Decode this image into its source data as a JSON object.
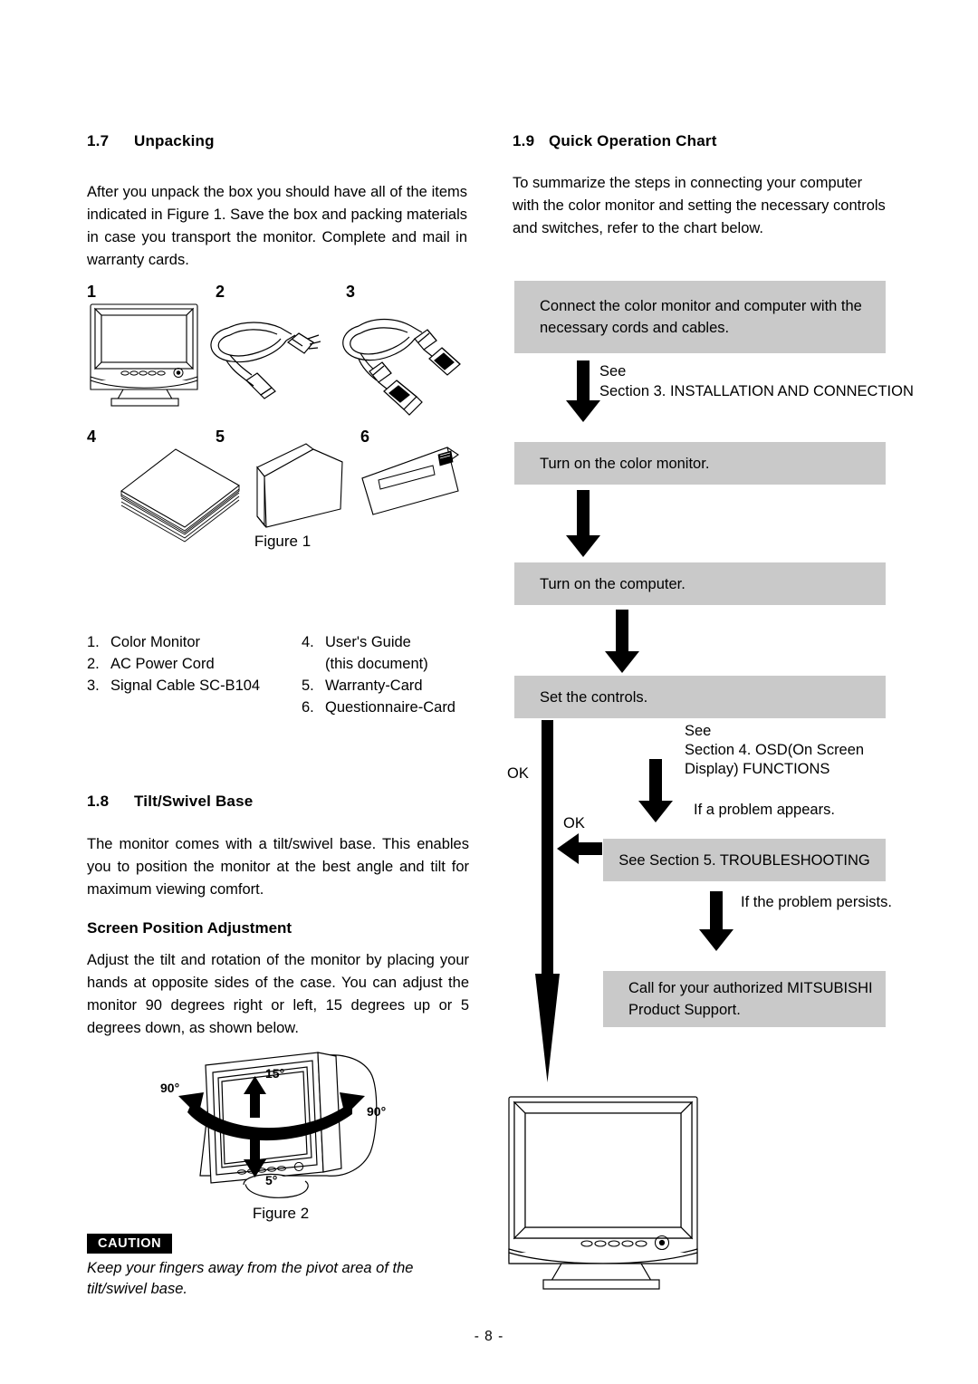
{
  "left_column": {
    "unpacking": {
      "number": "1.7",
      "title": "Unpacking",
      "paragraph": "After you unpack the box you should have all of the items indicated in Figure 1.  Save the box and packing materials in case you  transport the monitor.  Complete and mail in warranty cards."
    },
    "figure1": {
      "caption": "Figure  1",
      "callouts": [
        "1",
        "2",
        "3",
        "4",
        "5",
        "6"
      ],
      "items_left": [
        {
          "index": "1.",
          "label": "Color Monitor"
        },
        {
          "index": "2.",
          "label": "AC Power Cord"
        },
        {
          "index": "3.",
          "label": "Signal Cable SC-B104"
        }
      ],
      "items_right": [
        {
          "index": "4.",
          "label": "User's Guide",
          "continuation": "(this document)"
        },
        {
          "index": "5.",
          "label": "Warranty-Card"
        },
        {
          "index": "6.",
          "label": "Questionnaire-Card"
        }
      ]
    },
    "tilt_swivel": {
      "number": "1.8",
      "title": "Tilt/Swivel Base",
      "paragraph": "The monitor comes with a tilt/swivel base.  This enables you to position the monitor at  the best angle and tilt for maximum viewing comfort.",
      "subheading": "Screen Position Adjustment",
      "sub_paragraph": "Adjust the tilt and rotation of the monitor by placing your hands at opposite sides of the case.  You can adjust the monitor 90 degrees right or left, 15 degrees up or 5 degrees down, as shown below."
    },
    "figure2": {
      "caption": "Figure  2",
      "angle_left": "90°",
      "angle_right": "90°",
      "angle_up": "15°",
      "angle_down": "5°"
    },
    "caution": {
      "tag": "CAUTION",
      "text": "Keep your fingers away from the pivot area of the tilt/swivel base."
    }
  },
  "right_column": {
    "heading": {
      "number": "1.9",
      "title": "Quick Operation Chart"
    },
    "intro": "To summarize the steps in connecting your computer with the color monitor and setting the necessary controls and switches, refer to the chart below.",
    "flow": {
      "box_connect": "Connect the color monitor and computer with the necessary cords and cables.",
      "note_see_1": "See",
      "note_section_3": "Section 3. INSTALLATION AND CONNECTION",
      "box_turn_on_monitor": "Turn on the color monitor.",
      "box_turn_on_computer": "Turn on the computer.",
      "box_set_controls": "Set the controls.",
      "note_see_2": "See",
      "note_section_4_line1": "Section 4. OSD(On Screen",
      "note_section_4_line2": "Display) FUNCTIONS",
      "note_problem_appears": "If a problem appears.",
      "box_troubleshooting": "See Section 5. TROUBLESHOOTING",
      "note_problem_persists": "If the problem persists.",
      "box_call_support": "Call for your authorized MITSUBISHI Product Support.",
      "ok_label_top": "OK",
      "ok_label_mid": "OK"
    }
  },
  "footer": {
    "page_number": "- 8 -"
  },
  "colors": {
    "flow_box_fill": "#c9c9c9",
    "ink": "#000000",
    "paper": "#ffffff"
  }
}
